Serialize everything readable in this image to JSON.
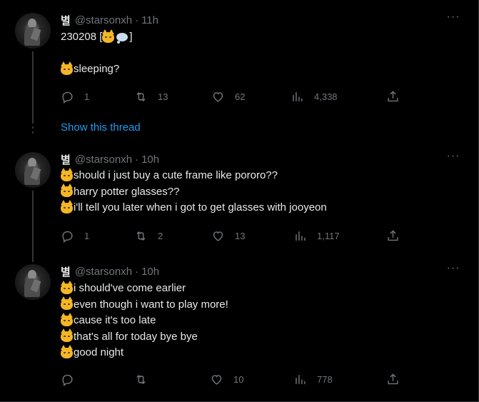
{
  "tweets": [
    {
      "name": "별",
      "handle": "@starsonxh",
      "time": "11h",
      "lines": [
        {
          "emoji": "",
          "text": "230208 [",
          "suffix": "]",
          "inline": "cat-thought"
        },
        {
          "emoji": "",
          "text": "",
          "blank": true
        },
        {
          "emoji": "cat",
          "text": "sleeping?"
        }
      ],
      "replies": "1",
      "retweets": "13",
      "likes": "62",
      "views": "4,338"
    },
    {
      "name": "별",
      "handle": "@starsonxh",
      "time": "10h",
      "lines": [
        {
          "emoji": "cat",
          "text": "should i just buy a cute frame like pororo??"
        },
        {
          "emoji": "cat",
          "text": "harry potter glasses??"
        },
        {
          "emoji": "cat",
          "text": "i'll tell you later when i got to get glasses with jooyeon"
        }
      ],
      "replies": "1",
      "retweets": "2",
      "likes": "13",
      "views": "1,117"
    },
    {
      "name": "별",
      "handle": "@starsonxh",
      "time": "10h",
      "lines": [
        {
          "emoji": "cat",
          "text": "i should've come earlier"
        },
        {
          "emoji": "cat",
          "text": "even though i want to play more!"
        },
        {
          "emoji": "cat",
          "text": "cause it's too late"
        },
        {
          "emoji": "cat",
          "text": "that's all for today bye bye"
        },
        {
          "emoji": "cat",
          "text": "good night"
        }
      ],
      "replies": "",
      "retweets": "",
      "likes": "10",
      "views": "778"
    }
  ],
  "show_thread_label": "Show this thread",
  "more_label": "···",
  "icons": {
    "reply": "reply-icon",
    "retweet": "retweet-icon",
    "like": "heart-icon",
    "views": "views-chart-icon",
    "share": "share-icon",
    "more": "more-icon"
  },
  "colors": {
    "background": "#000000",
    "text": "#e7e9ea",
    "secondary": "#71767b",
    "link": "#1d9bf0",
    "divider": "#2f3336"
  }
}
